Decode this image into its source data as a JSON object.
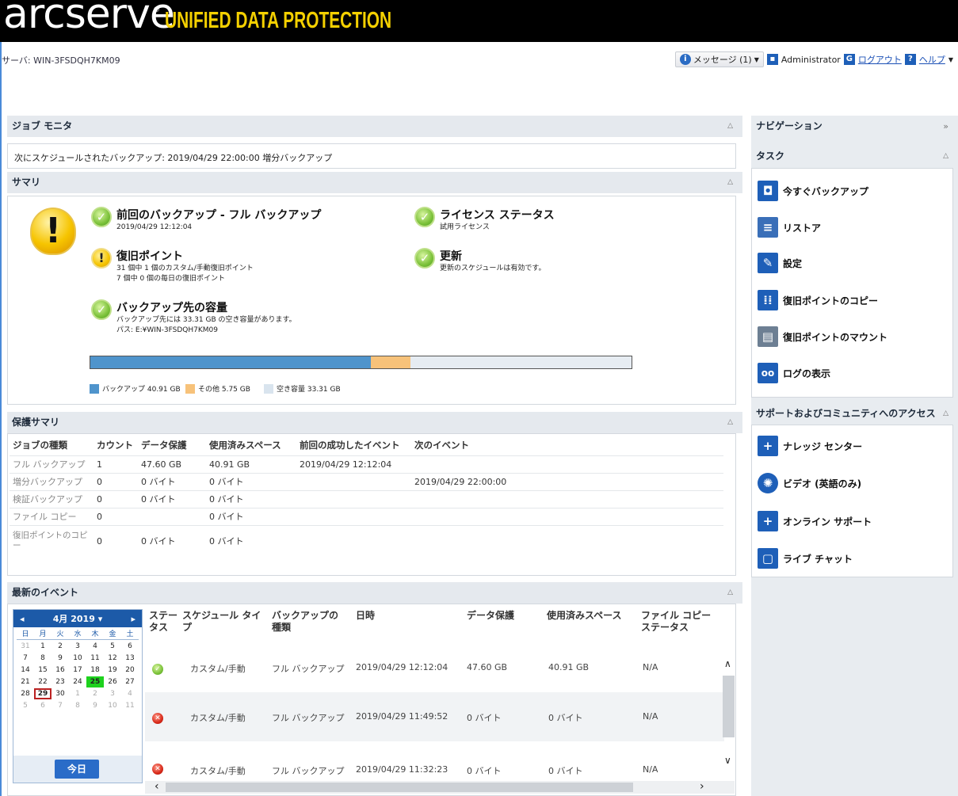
{
  "brand": {
    "name": "arcserve",
    "reg": "®",
    "product": "UNIFIED DATA PROTECTION"
  },
  "server_label": "サーバ: WIN-3FSDQH7KM09",
  "userbar": {
    "messages": "メッセージ (1)",
    "user": "Administrator",
    "logout": "ログアウト",
    "help": "ヘルプ"
  },
  "job_monitor": {
    "title": "ジョブ モニタ",
    "next_schedule": "次にスケジュールされたバックアップ: 2019/04/29 22:00:00 増分バックアップ"
  },
  "summary": {
    "title": "サマリ",
    "last_backup": {
      "title": "前回のバックアップ - フル バックアップ",
      "sub": "2019/04/29 12:12:04"
    },
    "recovery_point": {
      "title": "復旧ポイント",
      "sub1": "31 個中 1 個のカスタム/手動復旧ポイント",
      "sub2": "7 個中 0 個の毎日の復旧ポイント"
    },
    "destination": {
      "title": "バックアップ先の容量",
      "sub1": "バックアップ先には 33.31 GB の空き容量があります。",
      "sub2": "パス: E:¥WIN-3FSDQH7KM09"
    },
    "license": {
      "title": "ライセンス ステータス",
      "sub": "試用ライセンス"
    },
    "update": {
      "title": "更新",
      "sub": "更新のスケジュールは有効です。"
    },
    "capacity": {
      "backup_fraction": 0.518,
      "other_fraction": 0.073,
      "colors": {
        "backup": "#4f94cc",
        "other": "#f7c27a",
        "free": "#e6ecf2"
      }
    },
    "legend": {
      "backup": "バックアップ 40.91 GB",
      "other": "その他 5.75 GB",
      "free": "空き容量 33.31 GB"
    }
  },
  "protection": {
    "title": "保護サマリ",
    "headers": [
      "ジョブの種類",
      "カウント",
      "データ保護",
      "使用済みスペース",
      "前回の成功したイベント",
      "次のイベント"
    ],
    "rows": [
      [
        "フル バックアップ",
        "1",
        "47.60 GB",
        "40.91 GB",
        "2019/04/29 12:12:04",
        ""
      ],
      [
        "増分バックアップ",
        "0",
        "0 バイト",
        "0 バイト",
        "",
        "2019/04/29 22:00:00"
      ],
      [
        "検証バックアップ",
        "0",
        "0 バイト",
        "0 バイト",
        "",
        ""
      ],
      [
        "ファイル コピー",
        "0",
        "",
        "0 バイト",
        "",
        ""
      ],
      [
        "復旧ポイントのコピー",
        "0",
        "0 バイト",
        "0 バイト",
        "",
        ""
      ]
    ]
  },
  "events": {
    "title": "最新のイベント",
    "calendar": {
      "month": "4月 2019",
      "prev": "◂",
      "next": "▸",
      "dow": [
        "日",
        "月",
        "火",
        "水",
        "木",
        "金",
        "土"
      ],
      "today_label": "今日"
    },
    "headers": {
      "status": "ステータス",
      "schedule": "スケジュール タイプ",
      "backup_type": "バックアップの種類",
      "datetime": "日時",
      "data": "データ保護",
      "used": "使用済みスペース",
      "filecopy": "ファイル コピー ステータス"
    },
    "rows": [
      {
        "status": "ok",
        "schedule": "カスタム/手動",
        "type": "フル バックアップ",
        "datetime": "2019/04/29 12:12:04",
        "data": "47.60 GB",
        "used": "40.91 GB",
        "filecopy": "N/A"
      },
      {
        "status": "fail",
        "schedule": "カスタム/手動",
        "type": "フル バックアップ",
        "datetime": "2019/04/29 11:49:52",
        "data": "0 バイト",
        "used": "0 バイト",
        "filecopy": "N/A"
      },
      {
        "status": "fail",
        "schedule": "カスタム/手動",
        "type": "フル バックアップ",
        "datetime": "2019/04/29 11:32:23",
        "data": "0 バイト",
        "used": "0 バイト",
        "filecopy": "N/A"
      }
    ]
  },
  "navigation": {
    "title": "ナビゲーション",
    "tasks_title": "タスク",
    "tasks": [
      "今すぐバックアップ",
      "リストア",
      "設定",
      "復旧ポイントのコピー",
      "復旧ポイントのマウント",
      "ログの表示"
    ],
    "support_title": "サポートおよびコミュニティへのアクセス",
    "support": [
      "ナレッジ センター",
      "ビデオ (英語のみ)",
      "オンライン サポート",
      "ライブ チャット"
    ]
  }
}
